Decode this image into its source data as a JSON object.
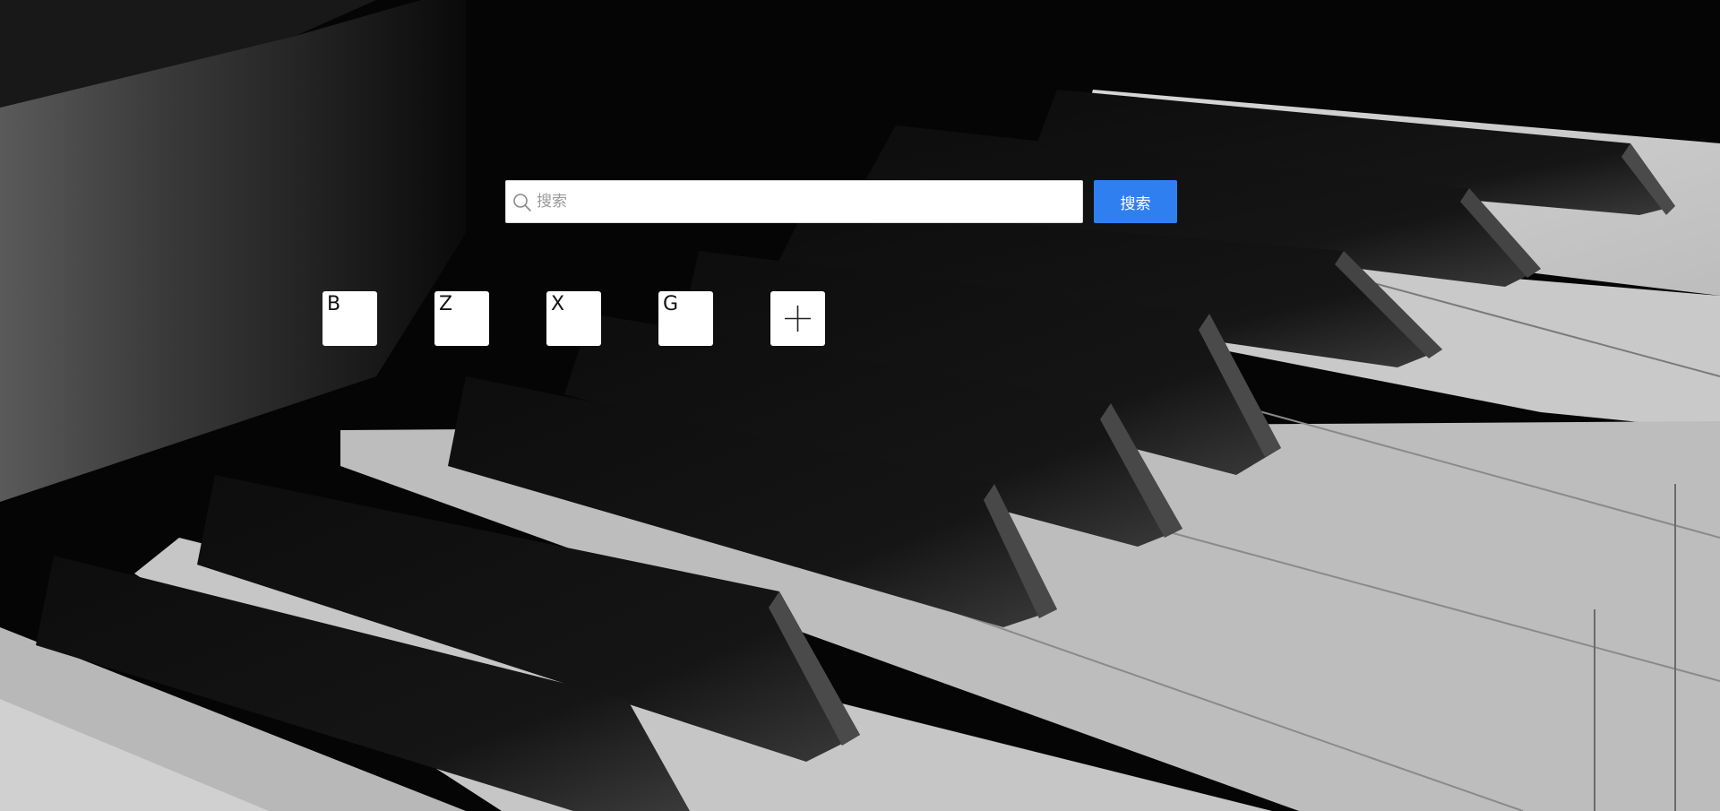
{
  "search": {
    "placeholder": "搜索",
    "button_label": "搜索"
  },
  "shortcuts": [
    {
      "label": "B"
    },
    {
      "label": "Z"
    },
    {
      "label": "X"
    },
    {
      "label": "G"
    }
  ],
  "add_shortcut": {
    "icon": "plus-icon"
  },
  "colors": {
    "accent": "#2f7ff0",
    "tile_bg": "#ffffff",
    "background": "#050505"
  },
  "background_image": {
    "subject": "piano keys"
  }
}
